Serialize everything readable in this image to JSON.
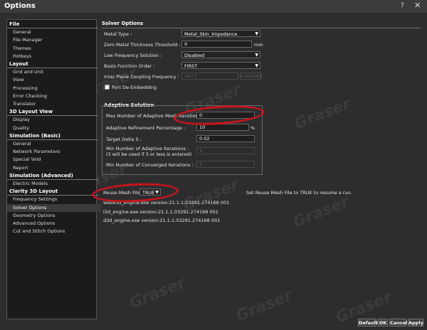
{
  "window": {
    "title": "Options",
    "help": "?",
    "close": "✕"
  },
  "sidebar": [
    {
      "type": "header",
      "label": "File"
    },
    {
      "type": "item",
      "label": "General"
    },
    {
      "type": "item",
      "label": "File Manager"
    },
    {
      "type": "item",
      "label": "Themes"
    },
    {
      "type": "item",
      "label": "Hotkeys"
    },
    {
      "type": "header",
      "label": "Layout"
    },
    {
      "type": "item",
      "label": "Grid and Unit"
    },
    {
      "type": "item",
      "label": "View"
    },
    {
      "type": "item",
      "label": "Processing"
    },
    {
      "type": "item",
      "label": "Error Checking"
    },
    {
      "type": "item",
      "label": "Translator"
    },
    {
      "type": "header",
      "label": "3D Layout View"
    },
    {
      "type": "item",
      "label": "Display"
    },
    {
      "type": "item",
      "label": "Quality"
    },
    {
      "type": "header",
      "label": "Simulation (Basic)"
    },
    {
      "type": "item",
      "label": "General"
    },
    {
      "type": "item",
      "label": "Network Parameters"
    },
    {
      "type": "item",
      "label": "Special Void"
    },
    {
      "type": "item",
      "label": "Report"
    },
    {
      "type": "header",
      "label": "Simulation (Advanced)"
    },
    {
      "type": "item",
      "label": "Electric Models"
    },
    {
      "type": "header",
      "label": "Clarity 3D Layout"
    },
    {
      "type": "item",
      "label": "Frequency Settings"
    },
    {
      "type": "item",
      "label": "Solver Options",
      "selected": true
    },
    {
      "type": "item",
      "label": "Geometry Options"
    },
    {
      "type": "item",
      "label": "Advanced Options"
    },
    {
      "type": "item",
      "label": "Cut and Stitch Options"
    }
  ],
  "solver": {
    "title": "Solver Options",
    "metal_type_label": "Metal Type :",
    "metal_type_value": "Metal_Skin_Impedance",
    "zero_thickness_label": "Zero Metal Thickness Threshold :",
    "zero_thickness_value": "0",
    "zero_thickness_unit": "mm",
    "low_freq_label": "Low Frequency Solution :",
    "low_freq_value": "Disabled",
    "basis_label": "Basis Function Order :",
    "basis_value": "FIRST",
    "coupling_label": "Inter Plane Coupling Frequency :",
    "coupling_value": "1e+7",
    "calculate_label": "Calculate",
    "port_deembed_label": "Port De-Embedding"
  },
  "adaptive": {
    "title": "Adaptive Solution",
    "max_iter_label": "Max Number of Adaptive Mesh Iterations :",
    "max_iter_value": "0",
    "refine_label": "Adaptive Refinement Percentage :",
    "refine_value": "10",
    "refine_unit": "%",
    "delta_label": "Target Delta S :",
    "delta_value": "0.02",
    "min_iter_label_1": "Min Number of Adaptive Iterations :",
    "min_iter_label_2": "(3 will be used if 3 or less is entered)",
    "min_iter_value": "1",
    "min_conv_label": "Min Number of Converged Iterations :",
    "min_conv_value": "1"
  },
  "reuse": {
    "label": "Reuse Mesh File :",
    "value": "TRUE",
    "hint": "Set Reuse Mesh File to TRUE to resume a run."
  },
  "versions": [
    "wave3d_engine.exe version:21.1.1.03291.274168   001",
    "l3d_engine.exe version:21.1.1.03291.274168   001",
    "d3d_engine.exe version:21.1.1.03291.274168   001"
  ],
  "buttons": {
    "default": "Default",
    "ok": "OK",
    "cancel": "Cancel",
    "apply": "Apply"
  },
  "watermark": "Graser",
  "colors": {
    "highlight_ring": "#c8141b",
    "background": "#2d2d30"
  }
}
